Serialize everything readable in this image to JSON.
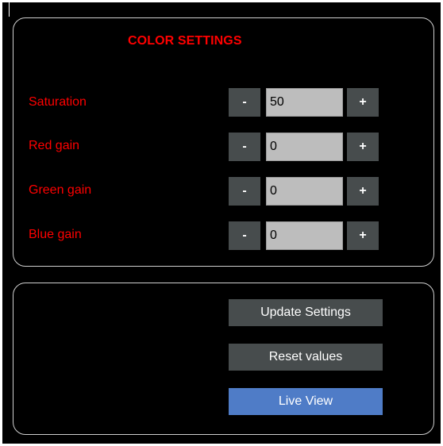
{
  "panel": {
    "title": "COLOR SETTINGS",
    "rows": [
      {
        "label": "Saturation",
        "minus": "-",
        "value": "50",
        "plus": "+"
      },
      {
        "label": "Red gain",
        "minus": "-",
        "value": "0",
        "plus": "+"
      },
      {
        "label": "Green gain",
        "minus": "-",
        "value": "0",
        "plus": "+"
      },
      {
        "label": "Blue gain",
        "minus": "-",
        "value": "0",
        "plus": "+"
      }
    ]
  },
  "actions": {
    "update_label": "Update Settings",
    "reset_label": "Reset values",
    "live_label": "Live View"
  },
  "colors": {
    "label_red": "#ff0000",
    "button_gray": "#474c4d",
    "field_gray": "#bdbdbd",
    "live_blue": "#4f7cc7",
    "panel_border": "#cfcfcf",
    "background": "#000000"
  }
}
